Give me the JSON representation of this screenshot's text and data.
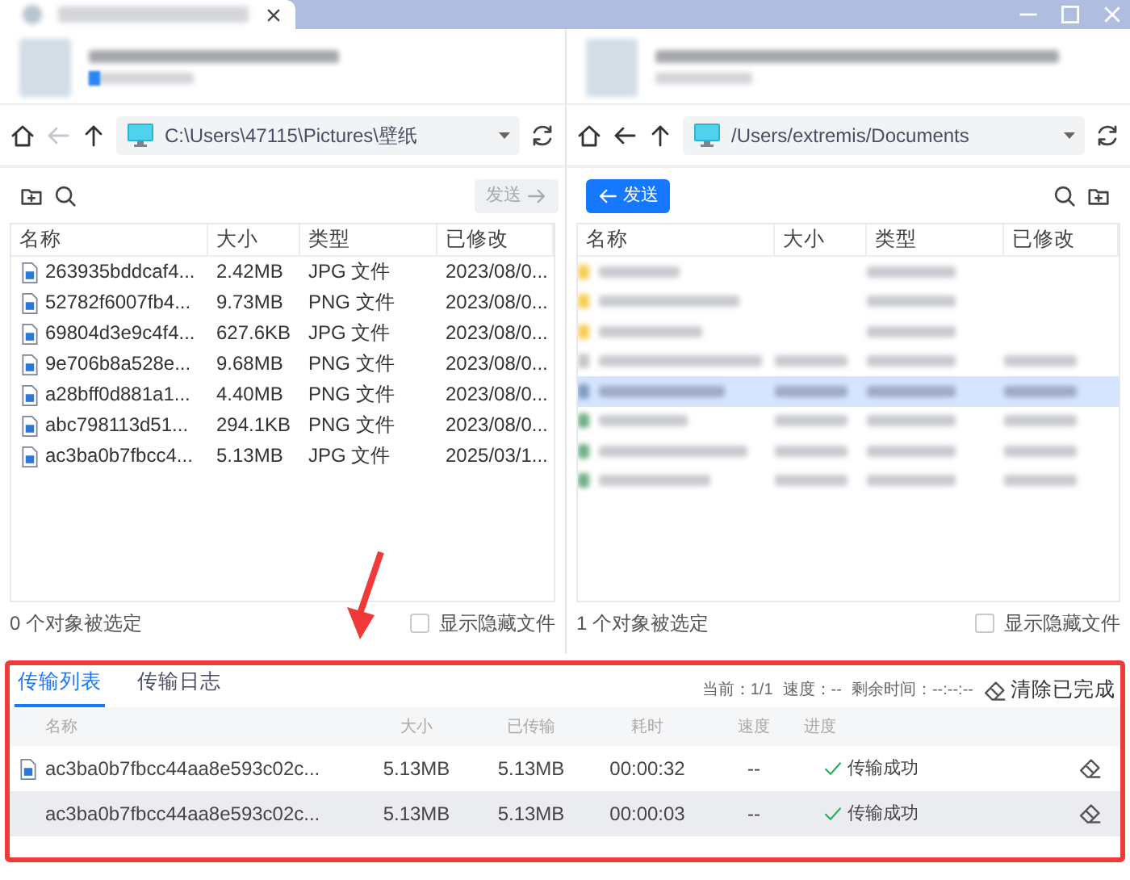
{
  "left_pane": {
    "path": "C:\\Users\\47115\\Pictures\\壁纸",
    "back_disabled": true,
    "send_button": {
      "label": "发送",
      "disabled": true
    },
    "columns": [
      "名称",
      "大小",
      "类型",
      "已修改"
    ],
    "files": [
      {
        "name": "263935bddcaf4...",
        "size": "2.42MB",
        "type": "JPG 文件",
        "modified": "2023/08/0..."
      },
      {
        "name": "52782f6007fb4...",
        "size": "9.73MB",
        "type": "PNG 文件",
        "modified": "2023/08/0..."
      },
      {
        "name": "69804d3e9c4f4...",
        "size": "627.6KB",
        "type": "JPG 文件",
        "modified": "2023/08/0..."
      },
      {
        "name": "9e706b8a528e...",
        "size": "9.68MB",
        "type": "PNG 文件",
        "modified": "2023/08/0..."
      },
      {
        "name": "a28bff0d881a1...",
        "size": "4.40MB",
        "type": "PNG 文件",
        "modified": "2023/08/0..."
      },
      {
        "name": "abc798113d51...",
        "size": "294.1KB",
        "type": "PNG 文件",
        "modified": "2023/08/0..."
      },
      {
        "name": "ac3ba0b7fbcc4...",
        "size": "5.13MB",
        "type": "JPG 文件",
        "modified": "2025/03/1..."
      }
    ],
    "selection_status": "0 个对象被选定",
    "show_hidden": {
      "label": "显示隐藏文件",
      "checked": false
    }
  },
  "right_pane": {
    "path": "/Users/extremis/Documents",
    "back_disabled": false,
    "send_button": {
      "label": "发送",
      "disabled": false
    },
    "columns": [
      "名称",
      "大小",
      "类型",
      "已修改"
    ],
    "rows": [
      {
        "kind": "folder",
        "has_details": false,
        "selected": false
      },
      {
        "kind": "folder",
        "has_details": false,
        "selected": false
      },
      {
        "kind": "folder",
        "has_details": false,
        "selected": false
      },
      {
        "kind": "file",
        "has_details": true,
        "selected": false
      },
      {
        "kind": "file",
        "has_details": true,
        "selected": true
      },
      {
        "kind": "sheet",
        "has_details": true,
        "selected": false
      },
      {
        "kind": "sheet",
        "has_details": true,
        "selected": false
      },
      {
        "kind": "sheet",
        "has_details": true,
        "selected": false
      }
    ],
    "selection_status": "1 个对象被选定",
    "show_hidden": {
      "label": "显示隐藏文件",
      "checked": false
    }
  },
  "transfer": {
    "highlighted": true,
    "tabs": [
      {
        "label": "传输列表",
        "selected": true
      },
      {
        "label": "传输日志",
        "selected": false
      }
    ],
    "current": "当前：1/1",
    "speed": "速度：--",
    "remaining": "剩余时间：--:--:--",
    "clear_button": "清除已完成",
    "columns": [
      "名称",
      "大小",
      "已传输",
      "耗时",
      "速度",
      "进度"
    ],
    "rows": [
      {
        "has_icon": true,
        "shaded": false,
        "name": "ac3ba0b7fbcc44aa8e593c02c...",
        "size": "5.13MB",
        "transferred": "5.13MB",
        "elapsed": "00:00:32",
        "speed": "--",
        "status": "传输成功",
        "done": true
      },
      {
        "has_icon": false,
        "shaded": true,
        "name": "ac3ba0b7fbcc44aa8e593c02c...",
        "size": "5.13MB",
        "transferred": "5.13MB",
        "elapsed": "00:00:03",
        "speed": "--",
        "status": "传输成功",
        "done": true
      }
    ]
  },
  "annotations": [
    {
      "kind": "arrow",
      "color": "#f03a3a"
    }
  ]
}
